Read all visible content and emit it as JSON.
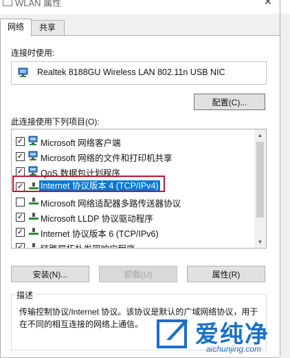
{
  "window": {
    "title": "WLAN 属性",
    "close_glyph": "✕"
  },
  "tabs": [
    {
      "label": "网络",
      "active": true
    },
    {
      "label": "共享",
      "active": false
    }
  ],
  "connect_using": {
    "label": "连接时使用:",
    "adapter": "Realtek 8188GU Wireless LAN 802.11n USB NIC"
  },
  "buttons": {
    "configure": "配置(C)...",
    "install": "安装(N)...",
    "uninstall": "卸载(U)",
    "properties": "属性(R)"
  },
  "items_label": "此连接使用下列项目(O):",
  "items": [
    {
      "label": "Microsoft 网络客户端",
      "checked": true,
      "icon": "network-client-icon"
    },
    {
      "label": "Microsoft 网络的文件和打印机共享",
      "checked": true,
      "icon": "file-sharing-icon"
    },
    {
      "label": "QoS 数据包计划程序",
      "checked": true,
      "icon": "qos-icon"
    },
    {
      "label": "Internet 协议版本 4 (TCP/IPv4)",
      "checked": true,
      "icon": "protocol-icon",
      "selected": true
    },
    {
      "label": "Microsoft 网络适配器多路传送器协议",
      "checked": false,
      "icon": "protocol-icon"
    },
    {
      "label": "Microsoft LLDP 协议驱动程序",
      "checked": true,
      "icon": "protocol-icon"
    },
    {
      "label": "Internet 协议版本 6 (TCP/IPv6)",
      "checked": true,
      "icon": "protocol-icon"
    },
    {
      "label": "链路层拓扑发现响应程序",
      "checked": true,
      "icon": "protocol-icon"
    }
  ],
  "description": {
    "title": "描述",
    "text": "传输控制协议/Internet 协议。该协议是默认的广域网络协议，用于在不同的相互连接的网络上通信。"
  },
  "watermark": {
    "brand": "爱纯净",
    "url": "aichunjing.com"
  },
  "colors": {
    "selection": "#0078d7",
    "highlight_border": "#c8102e",
    "brand": "#1a6fc9"
  }
}
